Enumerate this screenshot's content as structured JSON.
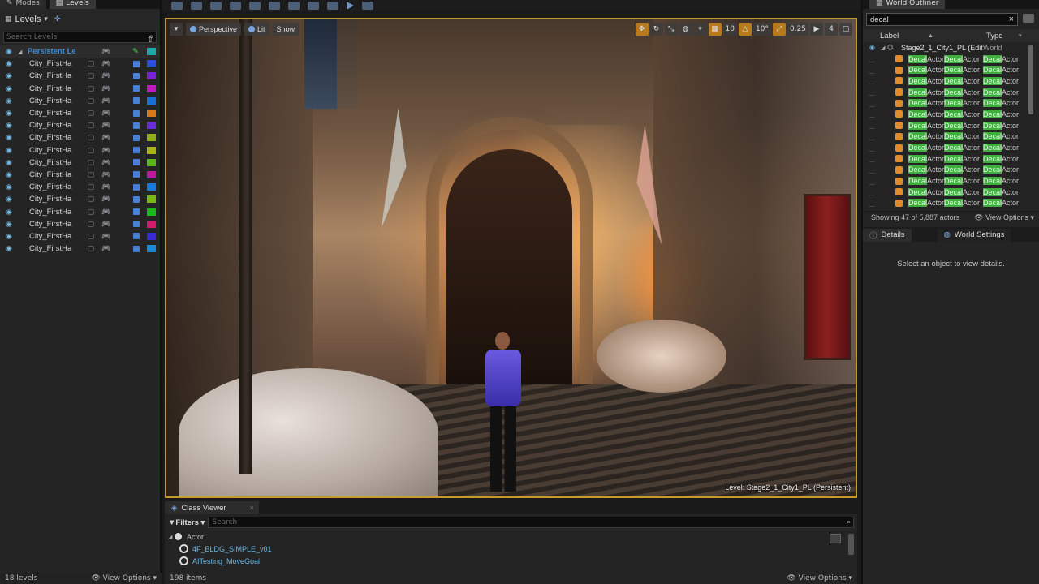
{
  "left_panel": {
    "tabs": [
      {
        "label": "Modes"
      },
      {
        "label": "Levels"
      }
    ],
    "header_title": "Levels",
    "search_placeholder": "Search Levels",
    "levels": [
      {
        "name": "Persistent Le",
        "color": "#1fa8a8",
        "persistent": true
      },
      {
        "name": "City_FirstHa",
        "color": "#2a4fd6"
      },
      {
        "name": "City_FirstHa",
        "color": "#7a22d6"
      },
      {
        "name": "City_FirstHa",
        "color": "#c01ac0"
      },
      {
        "name": "City_FirstHa",
        "color": "#1a6fd6"
      },
      {
        "name": "City_FirstHa",
        "color": "#d67a1a"
      },
      {
        "name": "City_FirstHa",
        "color": "#6a2ed6"
      },
      {
        "name": "City_FirstHa",
        "color": "#8fae1a"
      },
      {
        "name": "City_FirstHa",
        "color": "#a8b21a"
      },
      {
        "name": "City_FirstHa",
        "color": "#5ab81a"
      },
      {
        "name": "City_FirstHa",
        "color": "#b81a9a"
      },
      {
        "name": "City_FirstHa",
        "color": "#1a7ad6"
      },
      {
        "name": "City_FirstHa",
        "color": "#7ab81a"
      },
      {
        "name": "City_FirstHa",
        "color": "#1ab81a"
      },
      {
        "name": "City_FirstHa",
        "color": "#d61a6a"
      },
      {
        "name": "City_FirstHa",
        "color": "#3a2ad6"
      },
      {
        "name": "City_FirstHa",
        "color": "#1a8ad6"
      }
    ],
    "footer_count": "18 levels",
    "footer_view_options": "View Options"
  },
  "viewport": {
    "perspective_label": "Perspective",
    "lit_label": "Lit",
    "show_label": "Show",
    "grid_value": "10",
    "angle_value": "10°",
    "scale_value": "0.25",
    "camera_speed": "4",
    "level_label": "Level:  Stage2_1_City1_PL (Persistent)"
  },
  "class_viewer": {
    "tab_label": "Class Viewer",
    "filters_label": "Filters",
    "search_placeholder": "Search",
    "root_item": "Actor",
    "items": [
      "4F_BLDG_SIMPLE_v01",
      "AITesting_MoveGoal"
    ],
    "footer_count": "198 items",
    "footer_view_options": "View Options"
  },
  "world_outliner": {
    "tab_label": "World Outliner",
    "search_value": "decal",
    "col_label": "Label",
    "col_type": "Type",
    "root_name": "Stage2_1_City1_PL (Edit",
    "root_type": "World",
    "actor_prefix": "Decal",
    "actor_suffix": "Actor",
    "actor_rows": 15,
    "showing": "Showing 47 of 5,887 actors",
    "view_options": "View Options"
  },
  "details": {
    "tab_details": "Details",
    "tab_world_settings": "World Settings",
    "empty_message": "Select an object to view details."
  }
}
